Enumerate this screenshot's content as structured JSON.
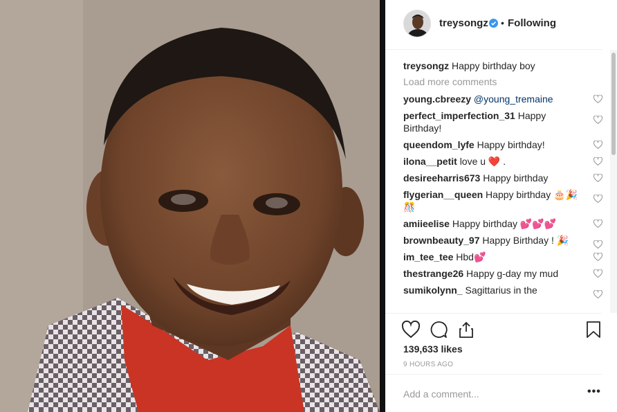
{
  "post": {
    "username": "treysongz",
    "follow_status": "Following",
    "separator": "•",
    "caption_text": "Happy birthday boy",
    "load_more": "Load more comments",
    "likes": "139,633 likes",
    "time": "9 HOURS AGO",
    "add_comment_placeholder": "Add a comment...",
    "more_options": "•••"
  },
  "comments": [
    {
      "user": "young.cbreezy",
      "text": "@young_tremaine",
      "mention": true
    },
    {
      "user": "perfect_imperfection_31",
      "text": "Happy Birthday!"
    },
    {
      "user": "queendom_lyfe",
      "text": "Happy birthday!"
    },
    {
      "user": "ilona__petit",
      "text": "love u ❤️ ."
    },
    {
      "user": "desireeharris673",
      "text": "Happy birthday"
    },
    {
      "user": "flygerian__queen",
      "text": "Happy birthday 🎂🎉🎊"
    },
    {
      "user": "amiieelise",
      "text": "Happy birthday 💕💕💕"
    },
    {
      "user": "brownbeauty_97",
      "text": "Happy Birthday ! 🎉"
    },
    {
      "user": "im_tee_tee",
      "text": "Hbd💕"
    },
    {
      "user": "thestrange26",
      "text": "Happy g-day my mud"
    },
    {
      "user": "sumikolynn_",
      "text": "Sagittarius in the"
    }
  ],
  "colors": {
    "accent_blue": "#3897f0",
    "link_blue": "#003569",
    "heart_red": "#ed4956",
    "muted_gray": "#999999"
  },
  "icons": [
    "verified-badge-icon",
    "heart-icon",
    "comment-icon",
    "share-icon",
    "bookmark-icon",
    "more-options-icon"
  ]
}
